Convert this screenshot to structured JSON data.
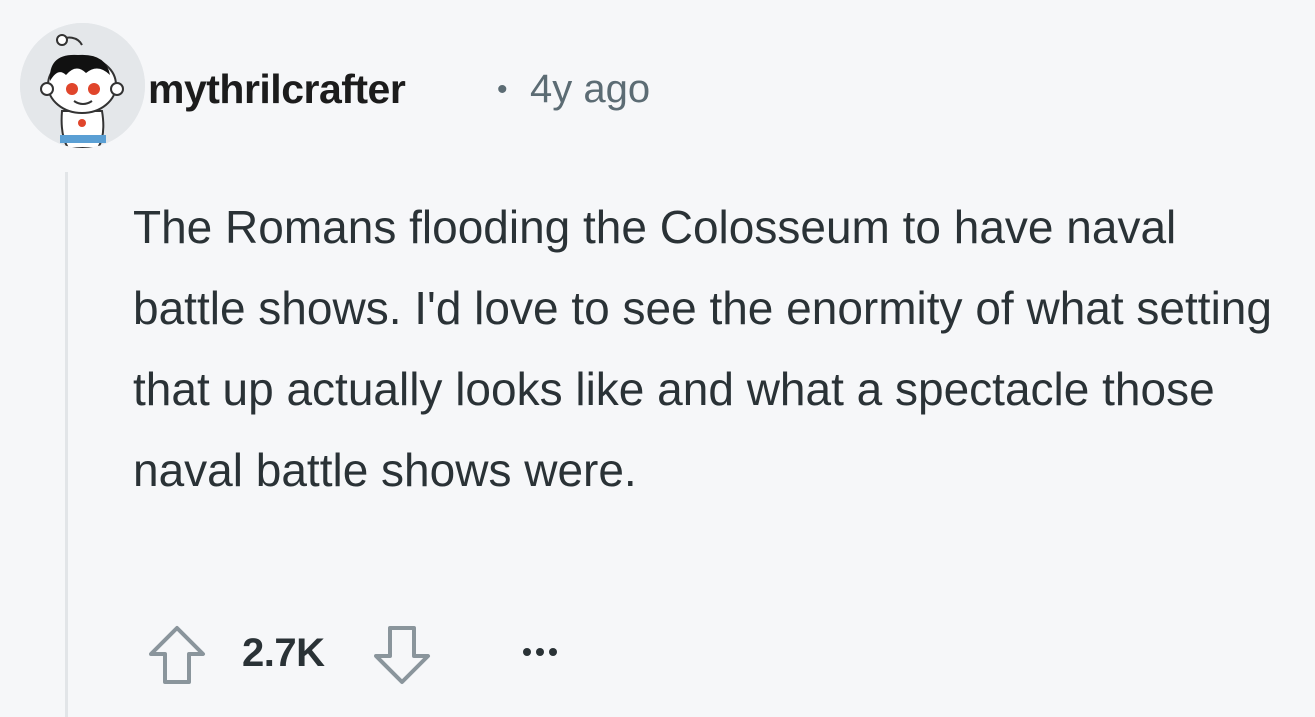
{
  "comment": {
    "author": "mythrilcrafter",
    "separator": "•",
    "timestamp": "4y ago",
    "body": "The Romans flooding the Colosseum to have naval battle shows. I'd love to see the enormity of what setting that up actually looks like and what a spectacle those naval battle shows were.",
    "score": "2.7K",
    "avatar_icon": "snoo-avatar-icon",
    "upvote_icon": "arrow-up-icon",
    "downvote_icon": "arrow-down-icon",
    "more_icon": "ellipsis-icon"
  },
  "colors": {
    "background": "#f6f7f9",
    "text": "#2a3236",
    "muted": "#5c6c74",
    "thread_line": "#e2e5e8"
  }
}
